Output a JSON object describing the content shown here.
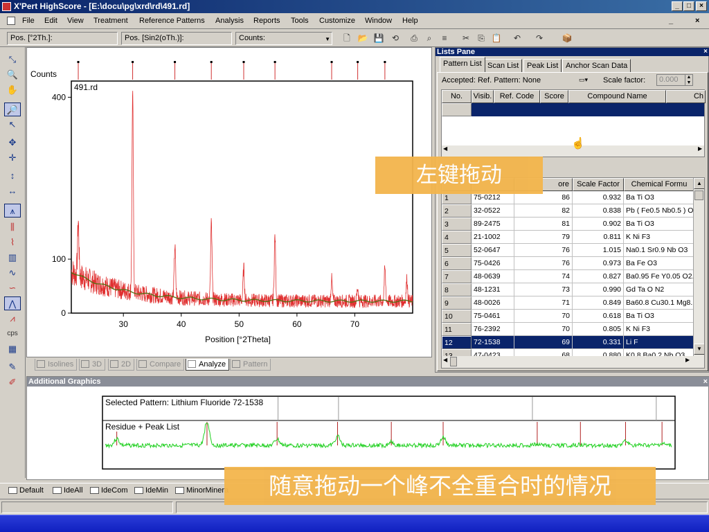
{
  "window": {
    "title": "X'Pert HighScore - [E:\\docu\\pg\\xrd\\rd\\491.rd]",
    "controls": [
      "_",
      "□",
      "×"
    ]
  },
  "menu": [
    "File",
    "Edit",
    "View",
    "Treatment",
    "Reference Patterns",
    "Analysis",
    "Reports",
    "Tools",
    "Customize",
    "Window",
    "Help"
  ],
  "menu_right": [
    "_",
    "×"
  ],
  "toolbar": {
    "pos1": "Pos. [°2Th.]:",
    "pos2": "Pos. [Sin2(oTh.)]:",
    "counts": "Counts:"
  },
  "left_toolbar": {
    "cps_label": "cps"
  },
  "chart_tabs": [
    "Isolines",
    "3D",
    "2D",
    "Compare",
    "Analyze",
    "Pattern"
  ],
  "chart_data": {
    "type": "line",
    "title": "491.rd",
    "xlabel": "Position [°2Theta]",
    "ylabel": "Counts",
    "xlim": [
      21,
      80
    ],
    "ylim": [
      0,
      430
    ],
    "xticks": [
      30,
      40,
      50,
      60,
      70
    ],
    "yticks": [
      0,
      100,
      400
    ],
    "peaks": [
      {
        "x": 22.2,
        "h": 100
      },
      {
        "x": 31.6,
        "h": 365
      },
      {
        "x": 38.9,
        "h": 95
      },
      {
        "x": 45.2,
        "h": 140
      },
      {
        "x": 50.8,
        "h": 60
      },
      {
        "x": 56.2,
        "h": 120
      },
      {
        "x": 66.0,
        "h": 40
      },
      {
        "x": 70.5,
        "h": 25
      },
      {
        "x": 75.2,
        "h": 60
      },
      {
        "x": 79.0,
        "h": 40
      }
    ],
    "reference_marks": [
      22.2,
      31.6,
      38.9,
      45.2,
      50.8,
      56.2,
      66.0,
      70.5,
      75.2
    ],
    "series": [
      {
        "color": "#e03030"
      },
      {
        "color": "#507010"
      }
    ]
  },
  "lists_pane": {
    "title": "Lists Pane",
    "tabs": [
      "Pattern List",
      "Scan List",
      "Peak List",
      "Anchor Scan Data"
    ],
    "accepted": "Accepted: Ref. Pattern: None",
    "scale_label": "Scale factor:",
    "scale_value": "0.000",
    "top_headers": [
      "No.",
      "Visib.",
      "Ref. Code",
      "Score",
      "Compound Name",
      "Ch"
    ],
    "headers": [
      "",
      "",
      "ore",
      "Scale Factor",
      "Chemical Formu"
    ],
    "rows": [
      [
        "1",
        "75-0212",
        "86",
        "0.932",
        "Ba Ti O3"
      ],
      [
        "2",
        "32-0522",
        "82",
        "0.838",
        "Pb ( Fe0.5 Nb0.5 ) O"
      ],
      [
        "3",
        "89-2475",
        "81",
        "0.902",
        "Ba Ti O3"
      ],
      [
        "4",
        "21-1002",
        "79",
        "0.811",
        "K Ni F3"
      ],
      [
        "5",
        "52-0647",
        "76",
        "1.015",
        "Na0.1 Sr0.9 Nb O3"
      ],
      [
        "6",
        "75-0426",
        "76",
        "0.973",
        "Ba Fe O3"
      ],
      [
        "7",
        "48-0639",
        "74",
        "0.827",
        "Ba0.95 Fe Y0.05 O2."
      ],
      [
        "8",
        "48-1231",
        "73",
        "0.990",
        "Gd Ta O N2"
      ],
      [
        "9",
        "48-0026",
        "71",
        "0.849",
        "Ba60.8 Cu30.1 Mg8."
      ],
      [
        "10",
        "75-0461",
        "70",
        "0.618",
        "Ba Ti O3"
      ],
      [
        "11",
        "76-2392",
        "70",
        "0.805",
        "K Ni F3"
      ],
      [
        "12",
        "72-1538",
        "69",
        "0.331",
        "Li F"
      ],
      [
        "13",
        "47-0423",
        "68",
        "0.880",
        "K0.8 Ba0.2 Nb O3"
      ]
    ],
    "selected_row": 11
  },
  "additional_graphics": {
    "title": "Additional Graphics",
    "selected_pattern": "Selected Pattern: Lithium Fluoride  72-1538",
    "residue_label": "Residue + Peak List"
  },
  "bottom_tabs": [
    "Default",
    "IdeAll",
    "IdeCom",
    "IdeMin",
    "MinorMinera"
  ],
  "overlays": {
    "drag_note": "左键拖动",
    "caption": "随意拖动一个峰不全重合时的情况"
  },
  "colors": {
    "titlebar": "#0a246a",
    "selection": "#0a246a",
    "data": "#e03030",
    "fit": "#507010",
    "residue": "#20d020",
    "overlay": "#f3b54c"
  }
}
